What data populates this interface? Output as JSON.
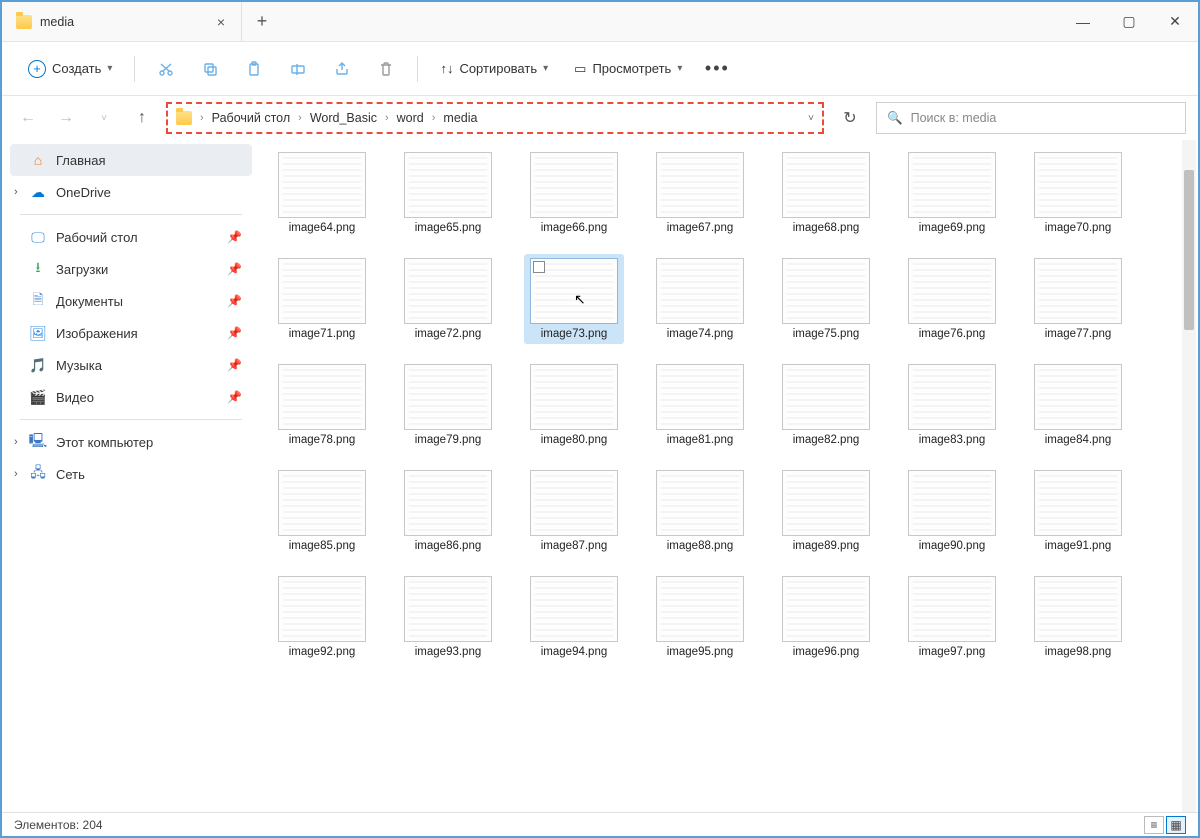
{
  "tab": {
    "title": "media"
  },
  "toolbar": {
    "create": "Создать",
    "sort": "Сортировать",
    "view": "Просмотреть"
  },
  "breadcrumb": [
    "Рабочий стол",
    "Word_Basic",
    "word",
    "media"
  ],
  "search_placeholder": "Поиск в: media",
  "sidebar": {
    "home": "Главная",
    "onedrive": "OneDrive",
    "quick": [
      "Рабочий стол",
      "Загрузки",
      "Документы",
      "Изображения",
      "Музыка",
      "Видео"
    ],
    "thispc": "Этот компьютер",
    "network": "Сеть"
  },
  "files": [
    "image64.png",
    "image65.png",
    "image66.png",
    "image67.png",
    "image68.png",
    "image69.png",
    "image70.png",
    "image71.png",
    "image72.png",
    "image73.png",
    "image74.png",
    "image75.png",
    "image76.png",
    "image77.png",
    "image78.png",
    "image79.png",
    "image80.png",
    "image81.png",
    "image82.png",
    "image83.png",
    "image84.png",
    "image85.png",
    "image86.png",
    "image87.png",
    "image88.png",
    "image89.png",
    "image90.png",
    "image91.png",
    "image92.png",
    "image93.png",
    "image94.png",
    "image95.png",
    "image96.png",
    "image97.png",
    "image98.png"
  ],
  "selected_index": 9,
  "status": "Элементов: 204"
}
